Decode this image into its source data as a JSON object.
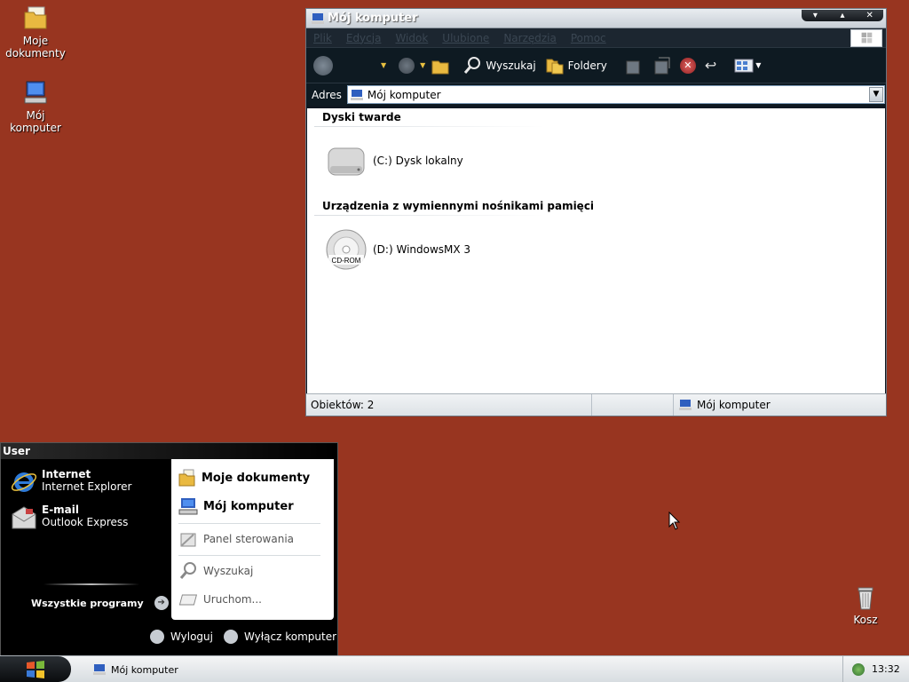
{
  "desktop": {
    "icons": [
      {
        "label": "Moje\ndokumenty"
      },
      {
        "label": "Mój komputer"
      },
      {
        "label": "Kosz"
      }
    ]
  },
  "window": {
    "title": "Mój komputer",
    "controls": [
      "▾",
      "▴",
      "✕"
    ],
    "menu": [
      "Plik",
      "Edycja",
      "Widok",
      "Ulubione",
      "Narzędzia",
      "Pomoc"
    ],
    "toolbar": {
      "search_label": "Wyszukaj",
      "folders_label": "Foldery"
    },
    "address": {
      "label": "Adres",
      "value": "Mój komputer"
    },
    "groups": [
      {
        "heading": "Dyski twarde",
        "items": [
          {
            "label": "(C:) Dysk lokalny",
            "icon": "hard-drive-icon"
          }
        ]
      },
      {
        "heading": "Urządzenia z wymiennymi nośnikami pamięci",
        "items": [
          {
            "label": "(D:) WindowsMX 3",
            "icon": "cdrom-icon",
            "badge": "CD-ROM"
          }
        ]
      }
    ],
    "status": {
      "objects": "Obiektów: 2",
      "location": "Mój komputer"
    }
  },
  "start_menu": {
    "user": "User",
    "pinned": [
      {
        "title": "Internet",
        "subtitle": "Internet Explorer"
      },
      {
        "title": "E-mail",
        "subtitle": "Outlook Express"
      }
    ],
    "all_programs": "Wszystkie programy",
    "right": [
      {
        "label": "Moje dokumenty"
      },
      {
        "label": "Mój komputer"
      },
      {
        "label": "Panel sterowania"
      },
      {
        "label": "Wyszukaj"
      },
      {
        "label": "Uruchom..."
      }
    ],
    "logoff": "Wyloguj",
    "shutdown": "Wyłącz komputer"
  },
  "taskbar": {
    "task_label": "Mój komputer",
    "clock": "13:32"
  }
}
